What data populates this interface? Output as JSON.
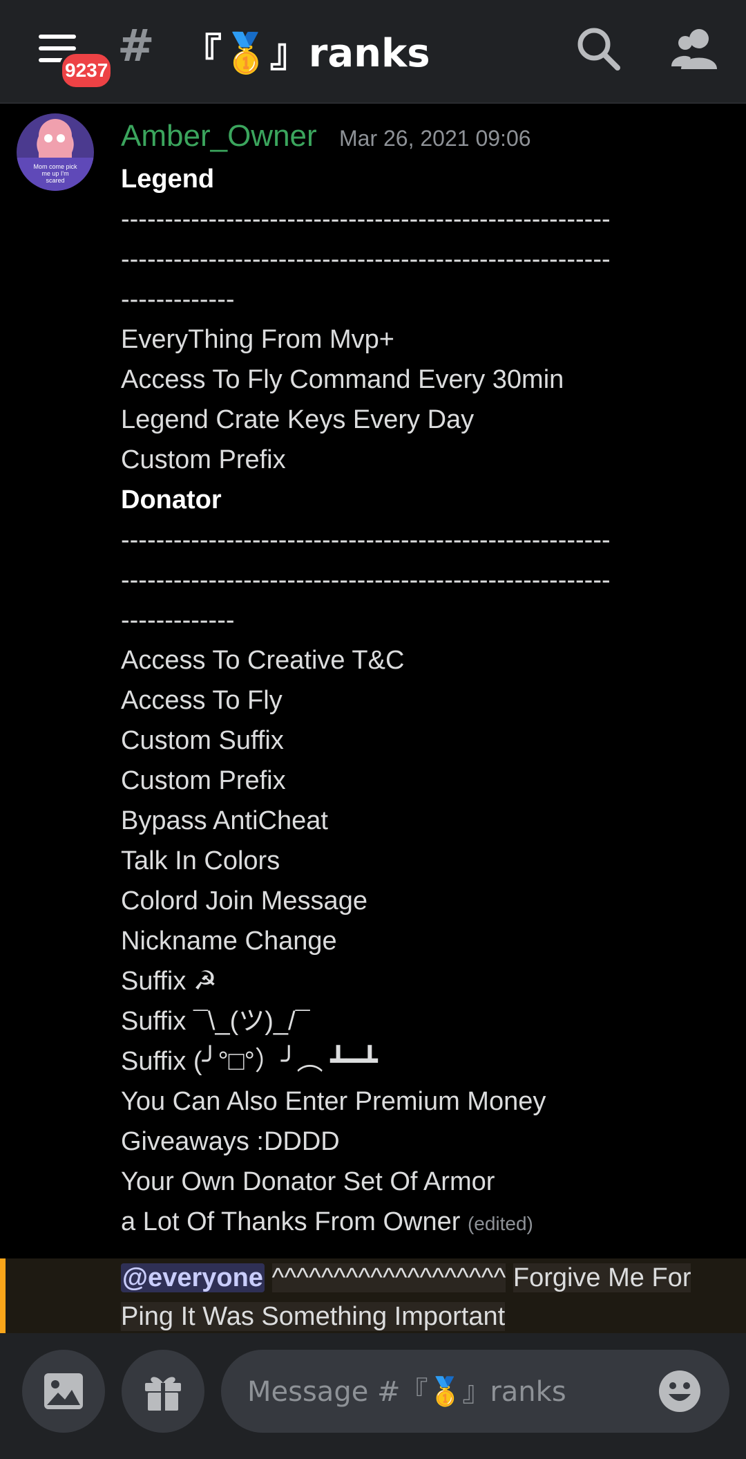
{
  "header": {
    "badge_count": "9237",
    "channel_name": "『🥇』ranks"
  },
  "message": {
    "author": "Amber_Owner",
    "timestamp": "Mar 26, 2021 09:06",
    "avatar_caption": "Mom come pick me up I'm scared",
    "lines": [
      {
        "text": "Legend",
        "style": "bold"
      },
      {
        "text": "--------------------------------------------------------",
        "style": "dash"
      },
      {
        "text": "--------------------------------------------------------",
        "style": "dash"
      },
      {
        "text": "-------------",
        "style": "dash"
      },
      {
        "text": "EveryThing From Mvp+",
        "style": "normal"
      },
      {
        "text": "Access To Fly Command Every 30min",
        "style": "normal"
      },
      {
        "text": "Legend Crate Keys Every Day",
        "style": "normal"
      },
      {
        "text": "Custom Prefix",
        "style": "normal"
      },
      {
        "text": "Donator",
        "style": "bold"
      },
      {
        "text": "--------------------------------------------------------",
        "style": "dash"
      },
      {
        "text": "--------------------------------------------------------",
        "style": "dash"
      },
      {
        "text": "-------------",
        "style": "dash"
      },
      {
        "text": "Access To Creative T&C",
        "style": "normal"
      },
      {
        "text": "Access To Fly",
        "style": "normal"
      },
      {
        "text": "Custom Suffix",
        "style": "normal"
      },
      {
        "text": "Custom Prefix",
        "style": "normal"
      },
      {
        "text": "Bypass AntiCheat",
        "style": "normal"
      },
      {
        "text": "Talk In Colors",
        "style": "normal"
      },
      {
        "text": "Colord Join Message",
        "style": "normal"
      },
      {
        "text": "Nickname Change",
        "style": "normal"
      },
      {
        "text": "Suffix ☭",
        "style": "normal"
      },
      {
        "text": "Suffix ¯\\_(ツ)_/¯",
        "style": "normal"
      },
      {
        "text": "Suffix (╯°□°）╯︵ ┻━┻",
        "style": "normal"
      },
      {
        "text": "You Can Also Enter Premium Money",
        "style": "normal"
      },
      {
        "text": "Giveaways :DDDD",
        "style": "normal"
      },
      {
        "text": "Your Own Donator Set Of Armor",
        "style": "normal"
      },
      {
        "text": "a Lot Of Thanks From Owner",
        "style": "normal"
      }
    ],
    "edited_label": "(edited)",
    "mention": "@everyone",
    "mention_carets": "^^^^^^^^^^^^^^^^^^^",
    "mention_rest_1": "Forgive Me For",
    "mention_rest_2": "Ping It Was Something Important"
  },
  "composer": {
    "placeholder": "Message #『🥇』ranks"
  },
  "colors": {
    "username": "#3ba55d",
    "mention_bar": "#faa61a",
    "badge": "#ed4245"
  },
  "icons": [
    "hamburger-menu-icon",
    "hash-icon",
    "search-icon",
    "members-icon",
    "image-icon",
    "gift-icon",
    "emoji-icon"
  ]
}
